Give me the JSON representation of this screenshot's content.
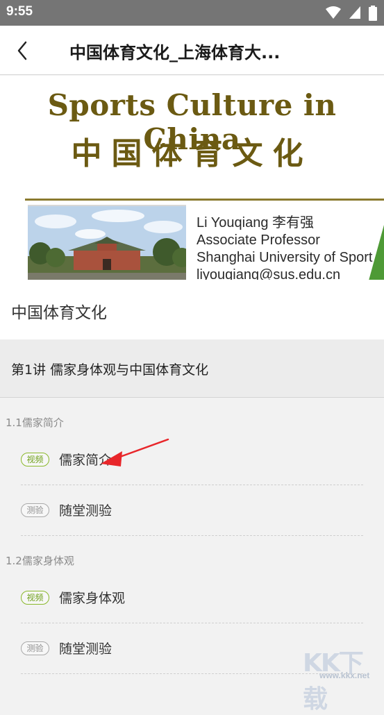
{
  "status_bar": {
    "time": "9:55",
    "icons": [
      "wifi-icon",
      "signal-icon",
      "battery-icon"
    ]
  },
  "header": {
    "title": "中国体育文化_上海体育大...",
    "back_icon": "chevron-left-icon"
  },
  "banner": {
    "title_en": "Sports Culture in China",
    "title_cn": "中国体育文化",
    "author": "Li Youqiang 李有强",
    "position": "Associate Professor",
    "university": "Shanghai University of Sport",
    "email": "liyouqiang@sus.edu.cn"
  },
  "course": {
    "name": "中国体育文化"
  },
  "chapter": {
    "title": "第1讲 儒家身体观与中国体育文化",
    "sections": [
      {
        "title": "1.1儒家简介",
        "items": [
          {
            "tag": "视频",
            "type": "video",
            "label": "儒家简介"
          },
          {
            "tag": "测验",
            "type": "quiz",
            "label": "随堂测验"
          }
        ]
      },
      {
        "title": "1.2儒家身体观",
        "items": [
          {
            "tag": "视频",
            "type": "video",
            "label": "儒家身体观"
          },
          {
            "tag": "测验",
            "type": "quiz",
            "label": "随堂测验"
          }
        ]
      }
    ]
  },
  "watermark": {
    "letters": "KK下载",
    "url": "www.kkx.net"
  },
  "colors": {
    "status_bar": "#757575",
    "banner_text": "#6b5a12",
    "video_tag": "#8ab82a",
    "quiz_tag": "#a9a9a9",
    "annotation_arrow": "#e8262a"
  }
}
